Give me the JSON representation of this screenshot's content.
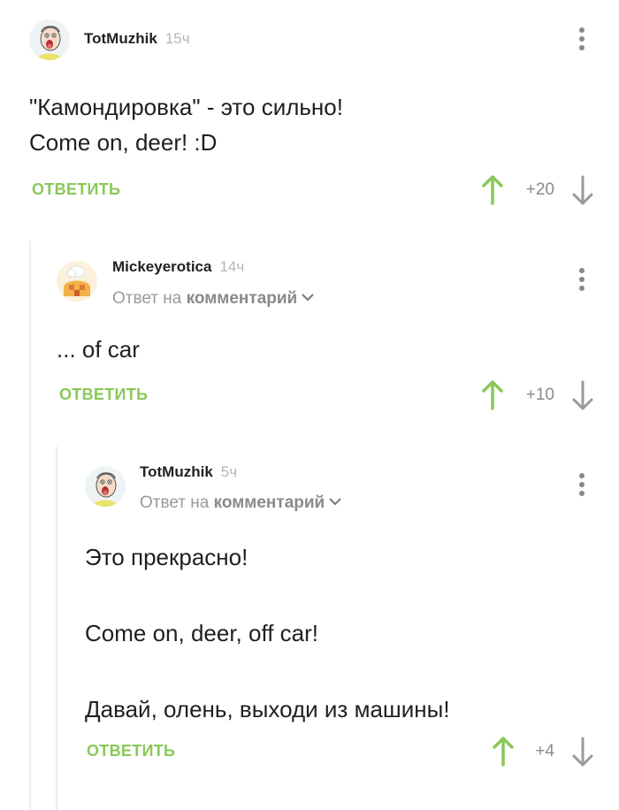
{
  "colors": {
    "accent_green": "#8ac858",
    "muted_gray": "#9a9a9a",
    "thread_line": "#ececec"
  },
  "comments": [
    {
      "username": "TotMuzhik",
      "time": "15ч",
      "avatar_icon": "cartoon-man-avatar",
      "lines": [
        "\"Камондировка\" - это сильно!",
        "Come on, deer! :D"
      ],
      "reply_label": "ОТВЕТИТЬ",
      "score": "+20"
    },
    {
      "username": "Mickeyerotica",
      "time": "14ч",
      "avatar_icon": "cartoon-house-avatar",
      "reply_prefix": "Ответ на",
      "reply_target": "комментарий",
      "lines": [
        "... of car"
      ],
      "reply_label": "ОТВЕТИТЬ",
      "score": "+10"
    },
    {
      "username": "TotMuzhik",
      "time": "5ч",
      "avatar_icon": "cartoon-man-avatar",
      "reply_prefix": "Ответ на",
      "reply_target": "комментарий",
      "lines": [
        "Это прекрасно!",
        "",
        "Come on, deer, off car!",
        "",
        "Давай, олень, выходи из машины!"
      ],
      "reply_label": "ОТВЕТИТЬ",
      "score": "+4"
    }
  ]
}
